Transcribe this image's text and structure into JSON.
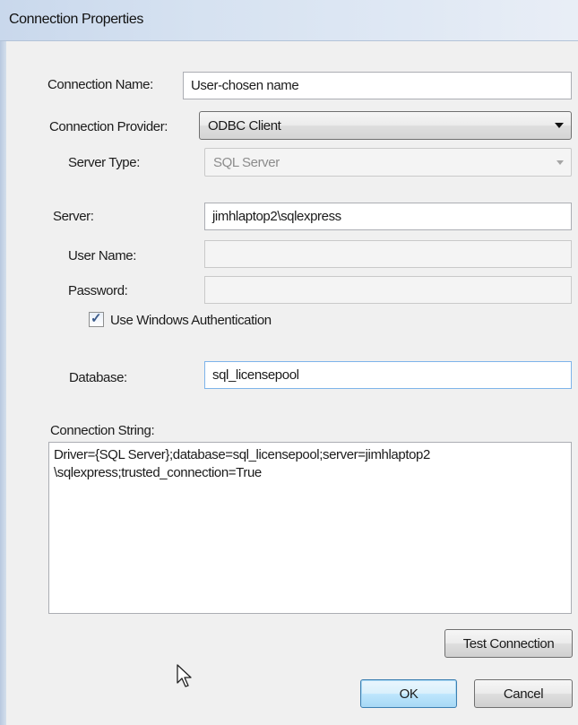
{
  "window": {
    "title": "Connection Properties"
  },
  "connection_name": {
    "label": "Connection Name:",
    "value": "User-chosen name"
  },
  "connection_provider": {
    "label": "Connection Provider:",
    "value": "ODBC Client"
  },
  "server_type": {
    "label": "Server Type:",
    "value": "SQL Server"
  },
  "server": {
    "label": "Server:",
    "value": "jimhlaptop2\\sqlexpress"
  },
  "user_name": {
    "label": "User Name:",
    "value": ""
  },
  "password": {
    "label": "Password:",
    "value": ""
  },
  "windows_auth": {
    "label": "Use Windows Authentication",
    "checked": true
  },
  "database": {
    "label": "Database:",
    "value": "sql_licensepool"
  },
  "connection_string": {
    "label": "Connection String:",
    "value": "Driver={SQL Server};database=sql_licensepool;server=jimhlaptop2\n\\sqlexpress;trusted_connection=True"
  },
  "buttons": {
    "test": "Test Connection",
    "ok": "OK",
    "cancel": "Cancel"
  },
  "icons": {
    "combo_arrow": "chevron-down-icon",
    "checkbox_mark": "checkmark-icon",
    "pointer": "mouse-pointer-icon"
  }
}
